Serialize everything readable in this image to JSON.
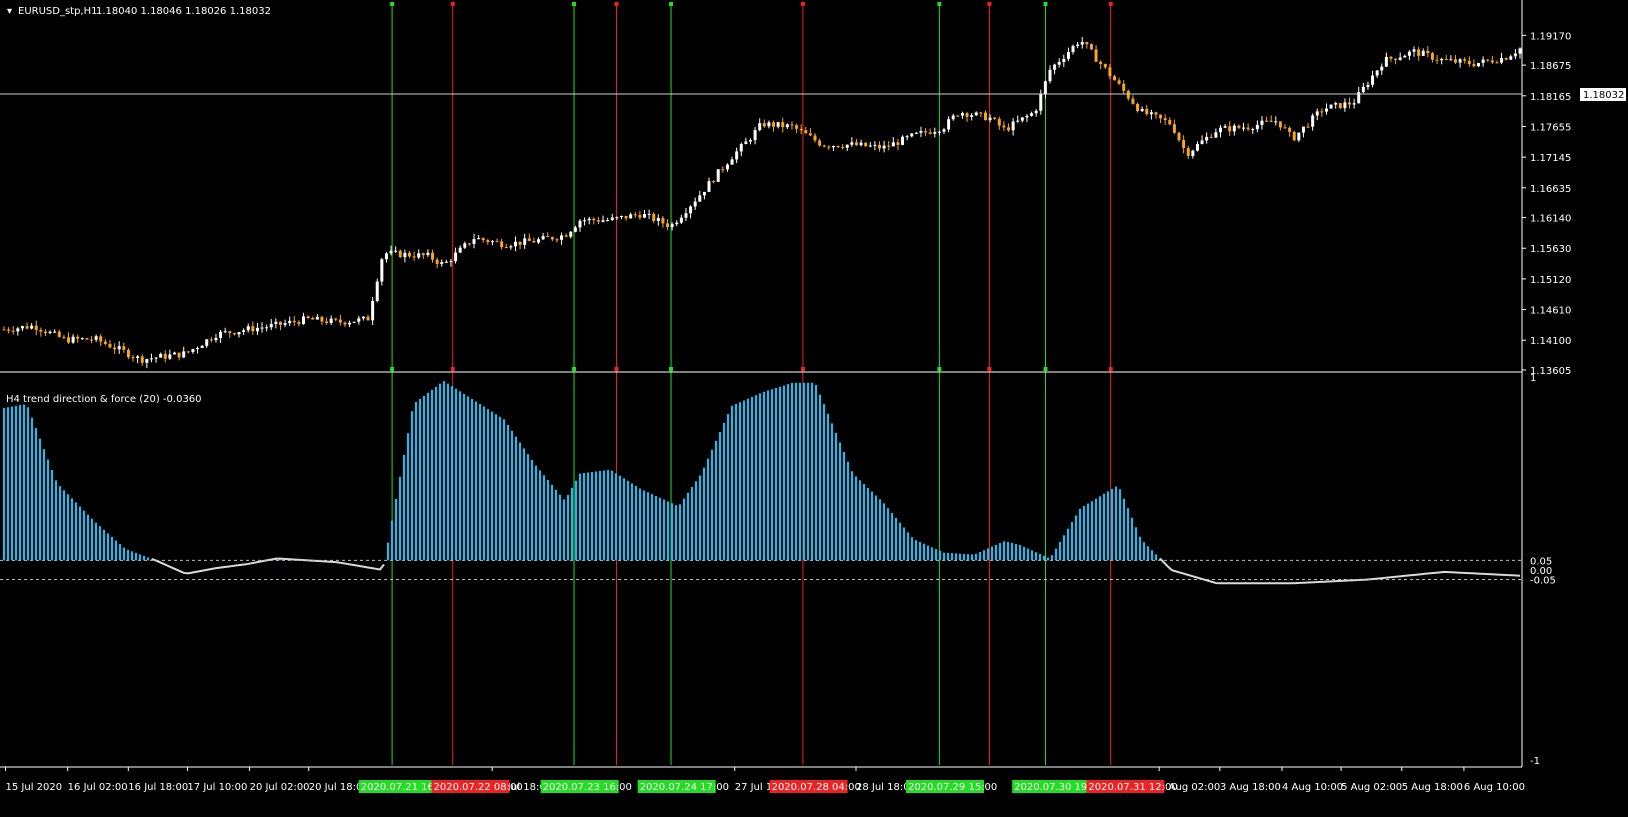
{
  "main_header": {
    "symbol_tf": "EURUSD_stp,H1",
    "ohlc": "1.18040 1.18046 1.18026 1.18032"
  },
  "indicator_header": {
    "label": "H4 trend direction & force (20) -0.0360"
  },
  "colors": {
    "background": "#000000",
    "bull_candle": "#ffffff",
    "bear_candle": "#f5a623",
    "histogram": "#29b6e8",
    "neutral_line": "#d9d9d9",
    "buy_line": "#22dd22",
    "sell_line": "#ee2222"
  },
  "chart_data": [
    {
      "type": "candlestick",
      "title": "EURUSD_stp,H1",
      "ylim": [
        1.13605,
        1.19675
      ],
      "price_ticks": [
        "1.19170",
        "1.18675",
        "1.18165",
        "1.17655",
        "1.17145",
        "1.16635",
        "1.16140",
        "1.15630",
        "1.15120",
        "1.14610",
        "1.14100",
        "1.13605"
      ],
      "current_price": "1.18032",
      "path_points": [
        [
          0,
          1.1428
        ],
        [
          0.02,
          1.1434
        ],
        [
          0.04,
          1.1411
        ],
        [
          0.06,
          1.1412
        ],
        [
          0.08,
          1.139
        ],
        [
          0.09,
          1.1378
        ],
        [
          0.12,
          1.1388
        ],
        [
          0.14,
          1.142
        ],
        [
          0.16,
          1.1428
        ],
        [
          0.18,
          1.1435
        ],
        [
          0.2,
          1.1445
        ],
        [
          0.22,
          1.144
        ],
        [
          0.24,
          1.1445
        ],
        [
          0.25,
          1.1555
        ],
        [
          0.28,
          1.155
        ],
        [
          0.29,
          1.1535
        ],
        [
          0.31,
          1.158
        ],
        [
          0.33,
          1.157
        ],
        [
          0.35,
          1.1575
        ],
        [
          0.37,
          1.1585
        ],
        [
          0.38,
          1.161
        ],
        [
          0.4,
          1.161
        ],
        [
          0.42,
          1.162
        ],
        [
          0.44,
          1.16
        ],
        [
          0.46,
          1.1655
        ],
        [
          0.48,
          1.1715
        ],
        [
          0.49,
          1.174
        ],
        [
          0.5,
          1.177
        ],
        [
          0.52,
          1.1765
        ],
        [
          0.54,
          1.1735
        ],
        [
          0.56,
          1.1735
        ],
        [
          0.58,
          1.173
        ],
        [
          0.6,
          1.175
        ],
        [
          0.62,
          1.1765
        ],
        [
          0.63,
          1.179
        ],
        [
          0.65,
          1.178
        ],
        [
          0.66,
          1.176
        ],
        [
          0.68,
          1.179
        ],
        [
          0.69,
          1.186
        ],
        [
          0.71,
          1.191
        ],
        [
          0.73,
          1.185
        ],
        [
          0.75,
          1.179
        ],
        [
          0.77,
          1.177
        ],
        [
          0.78,
          1.172
        ],
        [
          0.8,
          1.176
        ],
        [
          0.82,
          1.1765
        ],
        [
          0.84,
          1.1775
        ],
        [
          0.85,
          1.1745
        ],
        [
          0.87,
          1.1795
        ],
        [
          0.89,
          1.1805
        ],
        [
          0.91,
          1.1875
        ],
        [
          0.93,
          1.189
        ],
        [
          0.95,
          1.1875
        ],
        [
          0.97,
          1.187
        ],
        [
          0.99,
          1.188
        ],
        [
          1.0,
          1.1895
        ]
      ]
    },
    {
      "type": "histogram",
      "title": "H4 trend direction & force (20) -0.0360",
      "ylim": [
        -1,
        1
      ],
      "y_ticks": [
        "1",
        "0.05",
        "0.00",
        "-0.05",
        "-1"
      ],
      "levels": [
        0.05,
        -0.05
      ],
      "path_points": [
        [
          0,
          0.84
        ],
        [
          0.015,
          0.86
        ],
        [
          0.035,
          0.45
        ],
        [
          0.06,
          0.25
        ],
        [
          0.08,
          0.11
        ],
        [
          0.1,
          0.05
        ],
        [
          0.12,
          -0.02
        ],
        [
          0.14,
          0.01
        ],
        [
          0.16,
          0.03
        ],
        [
          0.18,
          0.06
        ],
        [
          0.2,
          0.05
        ],
        [
          0.22,
          0.04
        ],
        [
          0.25,
          0.0
        ],
        [
          0.27,
          0.86
        ],
        [
          0.29,
          0.98
        ],
        [
          0.31,
          0.88
        ],
        [
          0.33,
          0.78
        ],
        [
          0.35,
          0.55
        ],
        [
          0.37,
          0.36
        ],
        [
          0.38,
          0.5
        ],
        [
          0.4,
          0.52
        ],
        [
          0.42,
          0.42
        ],
        [
          0.445,
          0.33
        ],
        [
          0.46,
          0.5
        ],
        [
          0.48,
          0.85
        ],
        [
          0.5,
          0.92
        ],
        [
          0.52,
          0.97
        ],
        [
          0.535,
          0.97
        ],
        [
          0.56,
          0.5
        ],
        [
          0.58,
          0.35
        ],
        [
          0.6,
          0.16
        ],
        [
          0.62,
          0.09
        ],
        [
          0.64,
          0.08
        ],
        [
          0.66,
          0.15
        ],
        [
          0.67,
          0.13
        ],
        [
          0.69,
          0.06
        ],
        [
          0.71,
          0.32
        ],
        [
          0.735,
          0.44
        ],
        [
          0.75,
          0.16
        ],
        [
          0.77,
          0.0
        ],
        [
          0.8,
          -0.07
        ],
        [
          0.85,
          -0.07
        ],
        [
          0.9,
          -0.05
        ],
        [
          0.95,
          -0.01
        ],
        [
          1.0,
          -0.03
        ]
      ]
    }
  ],
  "signals": [
    {
      "type": "buy",
      "x": 0.256
    },
    {
      "type": "sell",
      "x": 0.296
    },
    {
      "type": "buy",
      "x": 0.376
    },
    {
      "type": "sell",
      "x": 0.404
    },
    {
      "type": "buy",
      "x": 0.44
    },
    {
      "type": "sell",
      "x": 0.527
    },
    {
      "type": "buy",
      "x": 0.617
    },
    {
      "type": "sell",
      "x": 0.65
    },
    {
      "type": "buy",
      "x": 0.687
    },
    {
      "type": "sell",
      "x": 0.73
    }
  ],
  "time_axis": [
    {
      "label": "15 Jul 2020",
      "x": 0.001
    },
    {
      "label": "16 Jul 02:00",
      "x": 0.042
    },
    {
      "label": "16 Jul 18:00",
      "x": 0.082
    },
    {
      "label": "17 Jul 10:00",
      "x": 0.121
    },
    {
      "label": "20 Jul 02:00",
      "x": 0.162
    },
    {
      "label": "20 Jul 18:00",
      "x": 0.201
    },
    {
      "label": "22 Jul 18:00",
      "x": 0.322
    },
    {
      "label": "27 Jul 1",
      "x": 0.482
    },
    {
      "label": "28 Jul 18:00",
      "x": 0.562
    },
    {
      "label": "3 Aug 02:00",
      "x": 0.762
    },
    {
      "label": "3 Aug 18:00",
      "x": 0.802
    },
    {
      "label": "4 Aug 10:00",
      "x": 0.843
    },
    {
      "label": "5 Aug 02:00",
      "x": 0.882
    },
    {
      "label": "5 Aug 18:00",
      "x": 0.922
    },
    {
      "label": "6 Aug 10:00",
      "x": 0.963
    }
  ],
  "signal_time_labels": [
    {
      "label": "2020.07.21 16:00",
      "type": "buy",
      "x": 0.234
    },
    {
      "label": "2020.07.22 08:00",
      "type": "sell",
      "x": 0.282
    },
    {
      "label": "2020.07.23 16:00",
      "type": "buy",
      "x": 0.354
    },
    {
      "label": "2020.07.24 17:00",
      "type": "buy",
      "x": 0.418
    },
    {
      "label": "2020.07.28 04:00",
      "type": "sell",
      "x": 0.505
    },
    {
      "label": "2020.07.29 15:00",
      "type": "buy",
      "x": 0.595
    },
    {
      "label": "2020.07.30 19:00",
      "type": "buy",
      "x": 0.665
    },
    {
      "label": "2020.07.31 12:00",
      "type": "sell",
      "x": 0.714
    }
  ]
}
